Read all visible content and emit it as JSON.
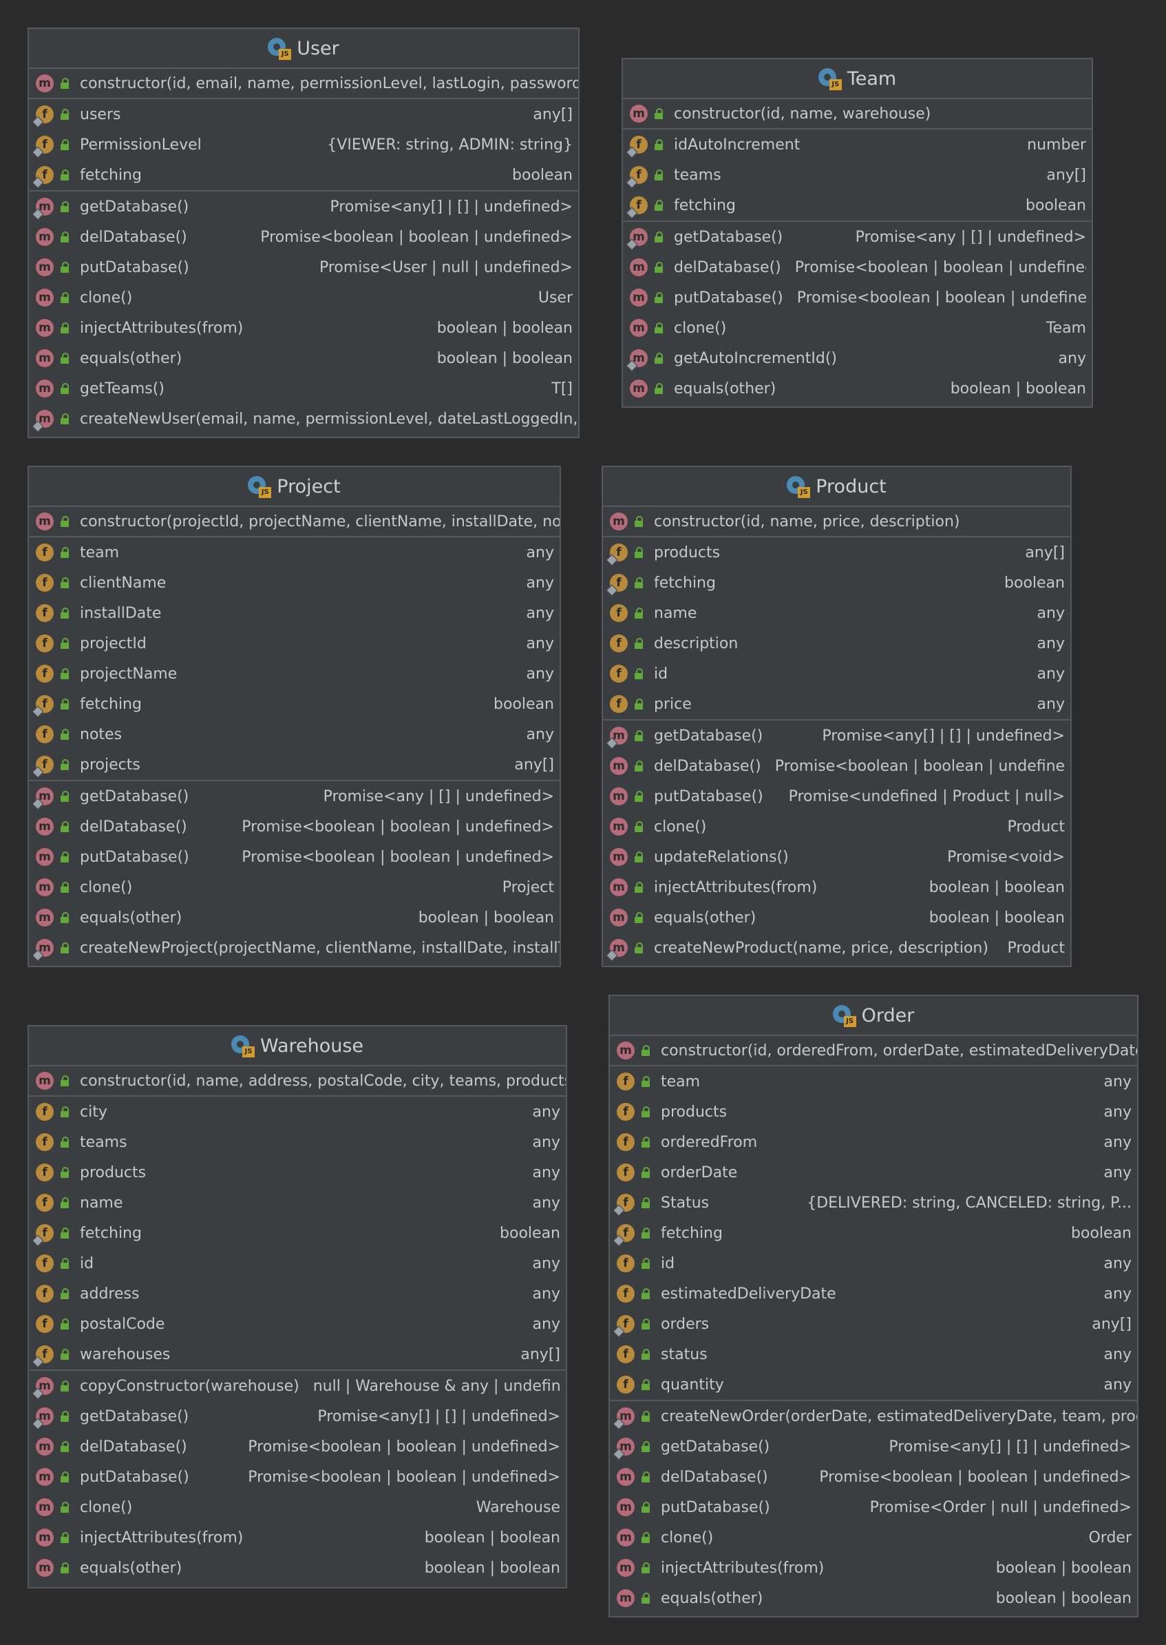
{
  "classes": {
    "user": {
      "title": "User",
      "ctor": "constructor(id, email, name, permissionLevel, lastLogin, password)",
      "fields": [
        {
          "kind": "f",
          "pin": true,
          "name": "users",
          "type": "any[]"
        },
        {
          "kind": "f",
          "pin": true,
          "name": "PermissionLevel",
          "type": "{VIEWER: string, ADMIN: string}"
        },
        {
          "kind": "f",
          "pin": true,
          "name": "fetching",
          "type": "boolean"
        }
      ],
      "methods": [
        {
          "kind": "m",
          "pin": true,
          "name": "getDatabase()",
          "type": "Promise<any[] | [] | undefined>"
        },
        {
          "kind": "m",
          "pin": false,
          "name": "delDatabase()",
          "type": "Promise<boolean | boolean | undefined>"
        },
        {
          "kind": "m",
          "pin": false,
          "name": "putDatabase()",
          "type": "Promise<User | null | undefined>"
        },
        {
          "kind": "m",
          "pin": false,
          "name": "clone()",
          "type": "User"
        },
        {
          "kind": "m",
          "pin": false,
          "name": "injectAttributes(from)",
          "type": "boolean | boolean"
        },
        {
          "kind": "m",
          "pin": false,
          "name": "equals(other)",
          "type": "boolean | boolean"
        },
        {
          "kind": "m",
          "pin": false,
          "name": "getTeams()",
          "type": "T[]"
        },
        {
          "kind": "m",
          "pin": true,
          "name": "createNewUser(email, name, permissionLevel, dateLastLoggedIn, pa",
          "type": ""
        }
      ]
    },
    "team": {
      "title": "Team",
      "ctor": "constructor(id, name, warehouse)",
      "fields": [
        {
          "kind": "f",
          "pin": true,
          "name": "idAutoIncrement",
          "type": "number"
        },
        {
          "kind": "f",
          "pin": true,
          "name": "teams",
          "type": "any[]"
        },
        {
          "kind": "f",
          "pin": true,
          "name": "fetching",
          "type": "boolean"
        }
      ],
      "methods": [
        {
          "kind": "m",
          "pin": true,
          "name": "getDatabase()",
          "type": "Promise<any | [] | undefined>"
        },
        {
          "kind": "m",
          "pin": false,
          "name": "delDatabase()",
          "type": "Promise<boolean | boolean | undefined>"
        },
        {
          "kind": "m",
          "pin": false,
          "name": "putDatabase()",
          "type": "Promise<boolean | boolean | undefined>"
        },
        {
          "kind": "m",
          "pin": false,
          "name": "clone()",
          "type": "Team"
        },
        {
          "kind": "m",
          "pin": true,
          "name": "getAutoIncrementId()",
          "type": "any"
        },
        {
          "kind": "m",
          "pin": false,
          "name": "equals(other)",
          "type": "boolean | boolean"
        }
      ]
    },
    "project": {
      "title": "Project",
      "ctor": "constructor(projectId, projectName, clientName, installDate, notes",
      "fields": [
        {
          "kind": "f",
          "pin": false,
          "name": "team",
          "type": "any"
        },
        {
          "kind": "f",
          "pin": false,
          "name": "clientName",
          "type": "any"
        },
        {
          "kind": "f",
          "pin": false,
          "name": "installDate",
          "type": "any"
        },
        {
          "kind": "f",
          "pin": false,
          "name": "projectId",
          "type": "any"
        },
        {
          "kind": "f",
          "pin": false,
          "name": "projectName",
          "type": "any"
        },
        {
          "kind": "f",
          "pin": true,
          "name": "fetching",
          "type": "boolean"
        },
        {
          "kind": "f",
          "pin": false,
          "name": "notes",
          "type": "any"
        },
        {
          "kind": "f",
          "pin": true,
          "name": "projects",
          "type": "any[]"
        }
      ],
      "methods": [
        {
          "kind": "m",
          "pin": true,
          "name": "getDatabase()",
          "type": "Promise<any | [] | undefined>"
        },
        {
          "kind": "m",
          "pin": false,
          "name": "delDatabase()",
          "type": "Promise<boolean | boolean | undefined>"
        },
        {
          "kind": "m",
          "pin": false,
          "name": "putDatabase()",
          "type": "Promise<boolean | boolean | undefined>"
        },
        {
          "kind": "m",
          "pin": false,
          "name": "clone()",
          "type": "Project"
        },
        {
          "kind": "m",
          "pin": false,
          "name": "equals(other)",
          "type": "boolean | boolean"
        },
        {
          "kind": "m",
          "pin": true,
          "name": "createNewProject(projectName, clientName, installDate, installTea",
          "type": ""
        }
      ]
    },
    "product": {
      "title": "Product",
      "ctor": "constructor(id, name, price, description)",
      "fields": [
        {
          "kind": "f",
          "pin": true,
          "name": "products",
          "type": "any[]"
        },
        {
          "kind": "f",
          "pin": true,
          "name": "fetching",
          "type": "boolean"
        },
        {
          "kind": "f",
          "pin": false,
          "name": "name",
          "type": "any"
        },
        {
          "kind": "f",
          "pin": false,
          "name": "description",
          "type": "any"
        },
        {
          "kind": "f",
          "pin": false,
          "name": "id",
          "type": "any"
        },
        {
          "kind": "f",
          "pin": false,
          "name": "price",
          "type": "any"
        }
      ],
      "methods": [
        {
          "kind": "m",
          "pin": true,
          "name": "getDatabase()",
          "type": "Promise<any[] | [] | undefined>"
        },
        {
          "kind": "m",
          "pin": false,
          "name": "delDatabase()",
          "type": "Promise<boolean | boolean | undefined>"
        },
        {
          "kind": "m",
          "pin": false,
          "name": "putDatabase()",
          "type": "Promise<undefined | Product | null>"
        },
        {
          "kind": "m",
          "pin": false,
          "name": "clone()",
          "type": "Product"
        },
        {
          "kind": "m",
          "pin": false,
          "name": "updateRelations()",
          "type": "Promise<void>"
        },
        {
          "kind": "m",
          "pin": false,
          "name": "injectAttributes(from)",
          "type": "boolean | boolean"
        },
        {
          "kind": "m",
          "pin": false,
          "name": "equals(other)",
          "type": "boolean | boolean"
        },
        {
          "kind": "m",
          "pin": true,
          "name": "createNewProduct(name, price, description)",
          "type": "Product"
        }
      ]
    },
    "warehouse": {
      "title": "Warehouse",
      "ctor": "constructor(id, name, address, postalCode, city, teams, products)",
      "fields": [
        {
          "kind": "f",
          "pin": false,
          "name": "city",
          "type": "any"
        },
        {
          "kind": "f",
          "pin": false,
          "name": "teams",
          "type": "any"
        },
        {
          "kind": "f",
          "pin": false,
          "name": "products",
          "type": "any"
        },
        {
          "kind": "f",
          "pin": false,
          "name": "name",
          "type": "any"
        },
        {
          "kind": "f",
          "pin": true,
          "name": "fetching",
          "type": "boolean"
        },
        {
          "kind": "f",
          "pin": false,
          "name": "id",
          "type": "any"
        },
        {
          "kind": "f",
          "pin": false,
          "name": "address",
          "type": "any"
        },
        {
          "kind": "f",
          "pin": false,
          "name": "postalCode",
          "type": "any"
        },
        {
          "kind": "f",
          "pin": true,
          "name": "warehouses",
          "type": "any[]"
        }
      ],
      "methods": [
        {
          "kind": "m",
          "pin": true,
          "name": "copyConstructor(warehouse)",
          "type": "null | Warehouse & any | undefined"
        },
        {
          "kind": "m",
          "pin": true,
          "name": "getDatabase()",
          "type": "Promise<any[] | [] | undefined>"
        },
        {
          "kind": "m",
          "pin": false,
          "name": "delDatabase()",
          "type": "Promise<boolean | boolean | undefined>"
        },
        {
          "kind": "m",
          "pin": false,
          "name": "putDatabase()",
          "type": "Promise<boolean | boolean | undefined>"
        },
        {
          "kind": "m",
          "pin": false,
          "name": "clone()",
          "type": "Warehouse"
        },
        {
          "kind": "m",
          "pin": false,
          "name": "injectAttributes(from)",
          "type": "boolean | boolean"
        },
        {
          "kind": "m",
          "pin": false,
          "name": "equals(other)",
          "type": "boolean | boolean"
        }
      ]
    },
    "order": {
      "title": "Order",
      "ctor": "constructor(id, orderedFrom, orderDate, estimatedDeliveryDate, t",
      "fields": [
        {
          "kind": "f",
          "pin": false,
          "name": "team",
          "type": "any"
        },
        {
          "kind": "f",
          "pin": false,
          "name": "products",
          "type": "any"
        },
        {
          "kind": "f",
          "pin": false,
          "name": "orderedFrom",
          "type": "any"
        },
        {
          "kind": "f",
          "pin": false,
          "name": "orderDate",
          "type": "any"
        },
        {
          "kind": "f",
          "pin": true,
          "name": "Status",
          "type": "{DELIVERED: string, CANCELED: string, P..."
        },
        {
          "kind": "f",
          "pin": true,
          "name": "fetching",
          "type": "boolean"
        },
        {
          "kind": "f",
          "pin": false,
          "name": "id",
          "type": "any"
        },
        {
          "kind": "f",
          "pin": false,
          "name": "estimatedDeliveryDate",
          "type": "any"
        },
        {
          "kind": "f",
          "pin": true,
          "name": "orders",
          "type": "any[]"
        },
        {
          "kind": "f",
          "pin": false,
          "name": "status",
          "type": "any"
        },
        {
          "kind": "f",
          "pin": false,
          "name": "quantity",
          "type": "any"
        }
      ],
      "methods": [
        {
          "kind": "m",
          "pin": true,
          "name": "createNewOrder(orderDate, estimatedDeliveryDate, team, produc",
          "type": ""
        },
        {
          "kind": "m",
          "pin": true,
          "name": "getDatabase()",
          "type": "Promise<any[] | [] | undefined>"
        },
        {
          "kind": "m",
          "pin": false,
          "name": "delDatabase()",
          "type": "Promise<boolean | boolean | undefined>"
        },
        {
          "kind": "m",
          "pin": false,
          "name": "putDatabase()",
          "type": "Promise<Order | null | undefined>"
        },
        {
          "kind": "m",
          "pin": false,
          "name": "clone()",
          "type": "Order"
        },
        {
          "kind": "m",
          "pin": false,
          "name": "injectAttributes(from)",
          "type": "boolean | boolean"
        },
        {
          "kind": "m",
          "pin": false,
          "name": "equals(other)",
          "type": "boolean | boolean"
        }
      ]
    }
  },
  "badges": {
    "m": "m",
    "f": "f",
    "js": "JS"
  },
  "icons": {
    "class": "js-class-icon",
    "method": "method-icon",
    "field": "field-icon",
    "visibility": "public-lock-icon"
  }
}
